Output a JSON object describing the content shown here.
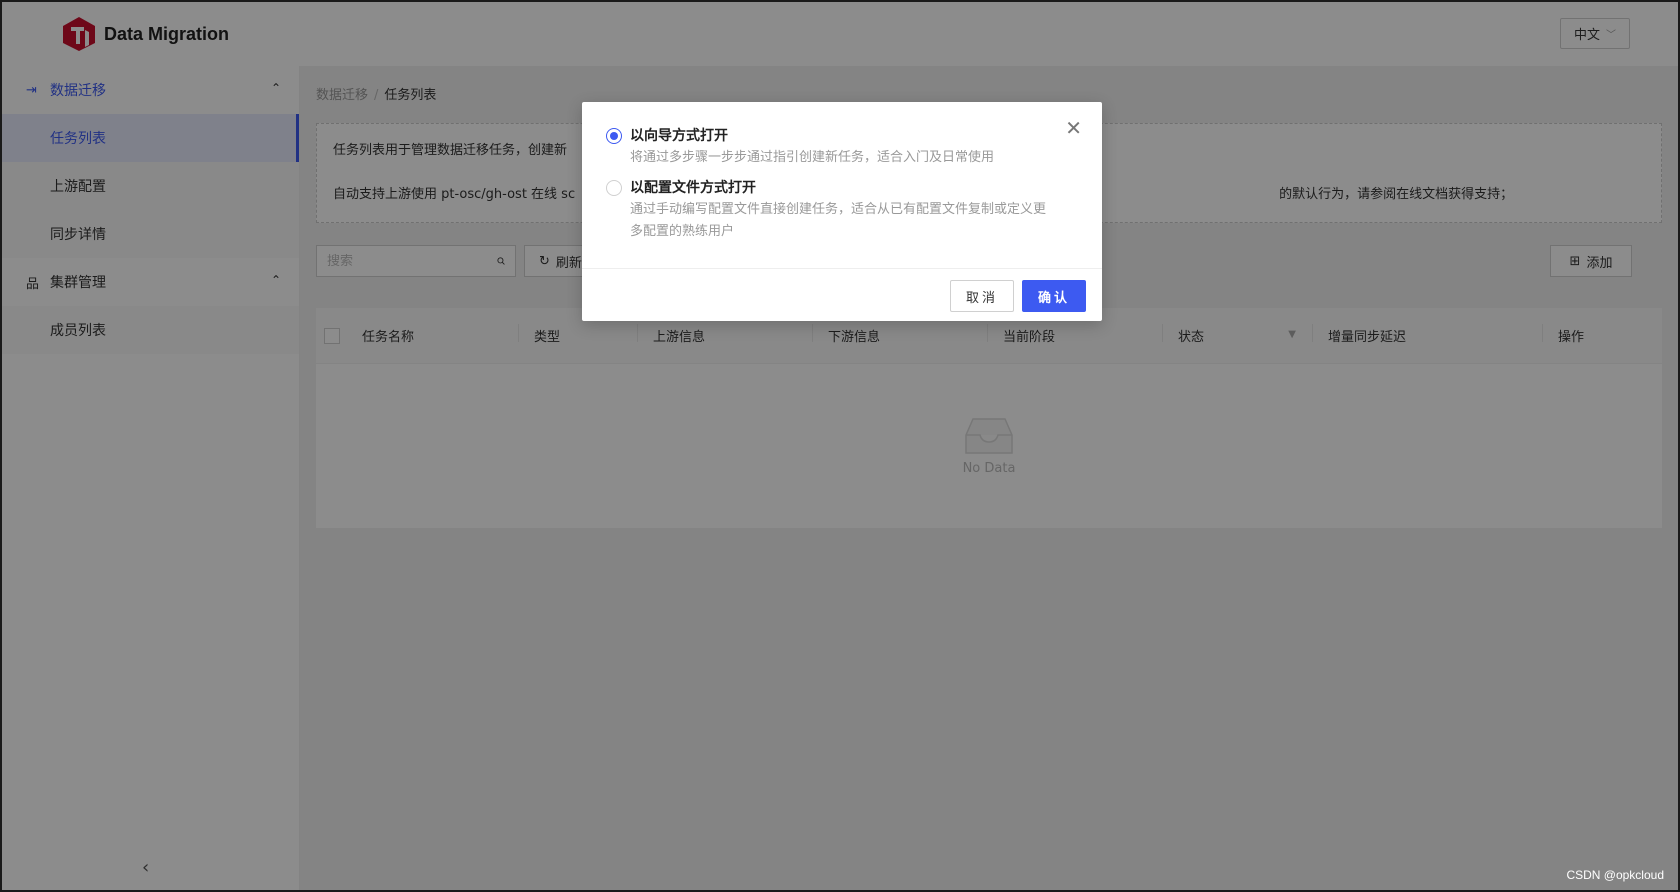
{
  "header": {
    "app_title": "Data Migration",
    "lang_label": "中文"
  },
  "sidebar": {
    "groups": [
      {
        "label": "数据迁移",
        "icon": "export-icon",
        "items": [
          "任务列表",
          "上游配置",
          "同步详情"
        ]
      },
      {
        "label": "集群管理",
        "icon": "cluster-icon",
        "items": [
          "成员列表"
        ]
      }
    ],
    "selected_item": "任务列表"
  },
  "breadcrumb": {
    "parent": "数据迁移",
    "separator": "/",
    "current": "任务列表"
  },
  "notice": {
    "line1": "任务列表用于管理数据迁移任务，创建新",
    "line2": "自动支持上游使用 pt-osc/gh-ost 在线 sc",
    "line2_tail": "的默认行为，请参阅在线文档获得支持；"
  },
  "toolbar": {
    "search_placeholder": "搜索",
    "refresh_label": "刷新",
    "add_label": "添加"
  },
  "table": {
    "columns": [
      "任务名称",
      "类型",
      "上游信息",
      "下游信息",
      "当前阶段",
      "状态",
      "增量同步延迟",
      "操作"
    ],
    "rows": [],
    "empty_text": "No Data"
  },
  "modal": {
    "options": [
      {
        "title": "以向导方式打开",
        "desc": "将通过多步骤一步步通过指引创建新任务，适合入门及日常使用",
        "checked": true
      },
      {
        "title": "以配置文件方式打开",
        "desc": "通过手动编写配置文件直接创建任务，适合从已有配置文件复制或定义更多配置的熟练用户",
        "checked": false
      }
    ],
    "cancel_label": "取消",
    "confirm_label": "确认"
  },
  "watermark": "CSDN @opkcloud",
  "colors": {
    "accent": "#3d5af1",
    "logo": "#c8102e"
  }
}
